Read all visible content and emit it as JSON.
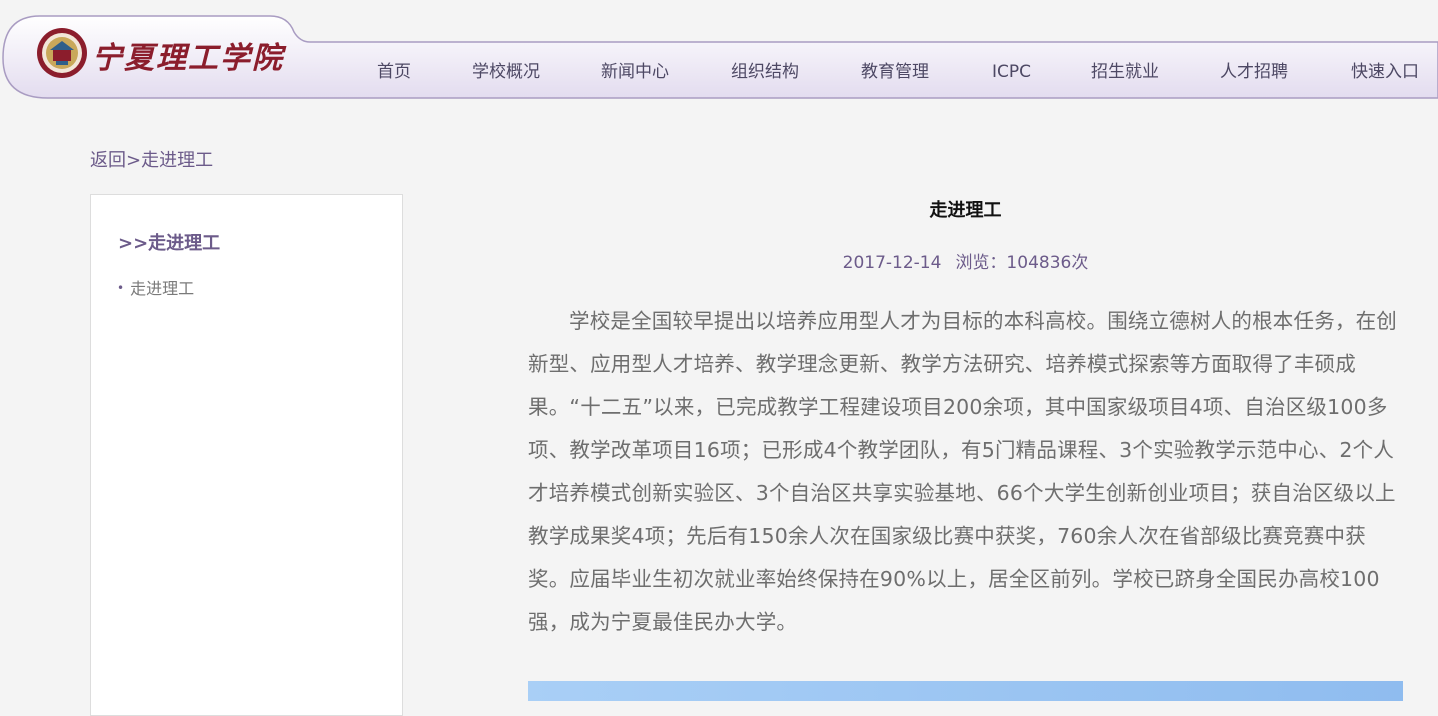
{
  "header": {
    "logo_text": "宁夏理工学院",
    "logo_icon": "university-emblem-icon",
    "nav": [
      {
        "label": "首页"
      },
      {
        "label": "学校概况"
      },
      {
        "label": "新闻中心"
      },
      {
        "label": "组织结构"
      },
      {
        "label": "教育管理"
      },
      {
        "label": "ICPC"
      },
      {
        "label": "招生就业"
      },
      {
        "label": "人才招聘"
      },
      {
        "label": "快速入口"
      }
    ]
  },
  "breadcrumb": {
    "back": "返回",
    "separator": ">",
    "current": "走进理工"
  },
  "sidebar": {
    "title": ">>走进理工",
    "items": [
      {
        "label": "走进理工"
      }
    ]
  },
  "article": {
    "title": "走进理工",
    "date": "2017-12-14",
    "views": "浏览：104836次",
    "body": "学校是全国较早提出以培养应用型人才为目标的本科高校。围绕立德树人的根本任务，在创新型、应用型人才培养、教学理念更新、教学方法研究、培养模式探索等方面取得了丰硕成果。“十二五”以来，已完成教学工程建设项目200余项，其中国家级项目4项、自治区级100多项、教学改革项目16项；已形成4个教学团队，有5门精品课程、3个实验教学示范中心、2个人才培养模式创新实验区、3个自治区共享实验基地、66个大学生创新创业项目；获自治区级以上教学成果奖4项；先后有150余人次在国家级比赛中获奖，760余人次在省部级比赛竞赛中获奖。应届毕业生初次就业率始终保持在90%以上，居全区前列。学校已跻身全国民办高校100强，成为宁夏最佳民办大学。"
  },
  "colors": {
    "accent": "#6c5b8a",
    "header_gradient_top": "#ffffff",
    "header_gradient_bottom": "#e3dcef",
    "logo_red": "#8b1d2c"
  }
}
